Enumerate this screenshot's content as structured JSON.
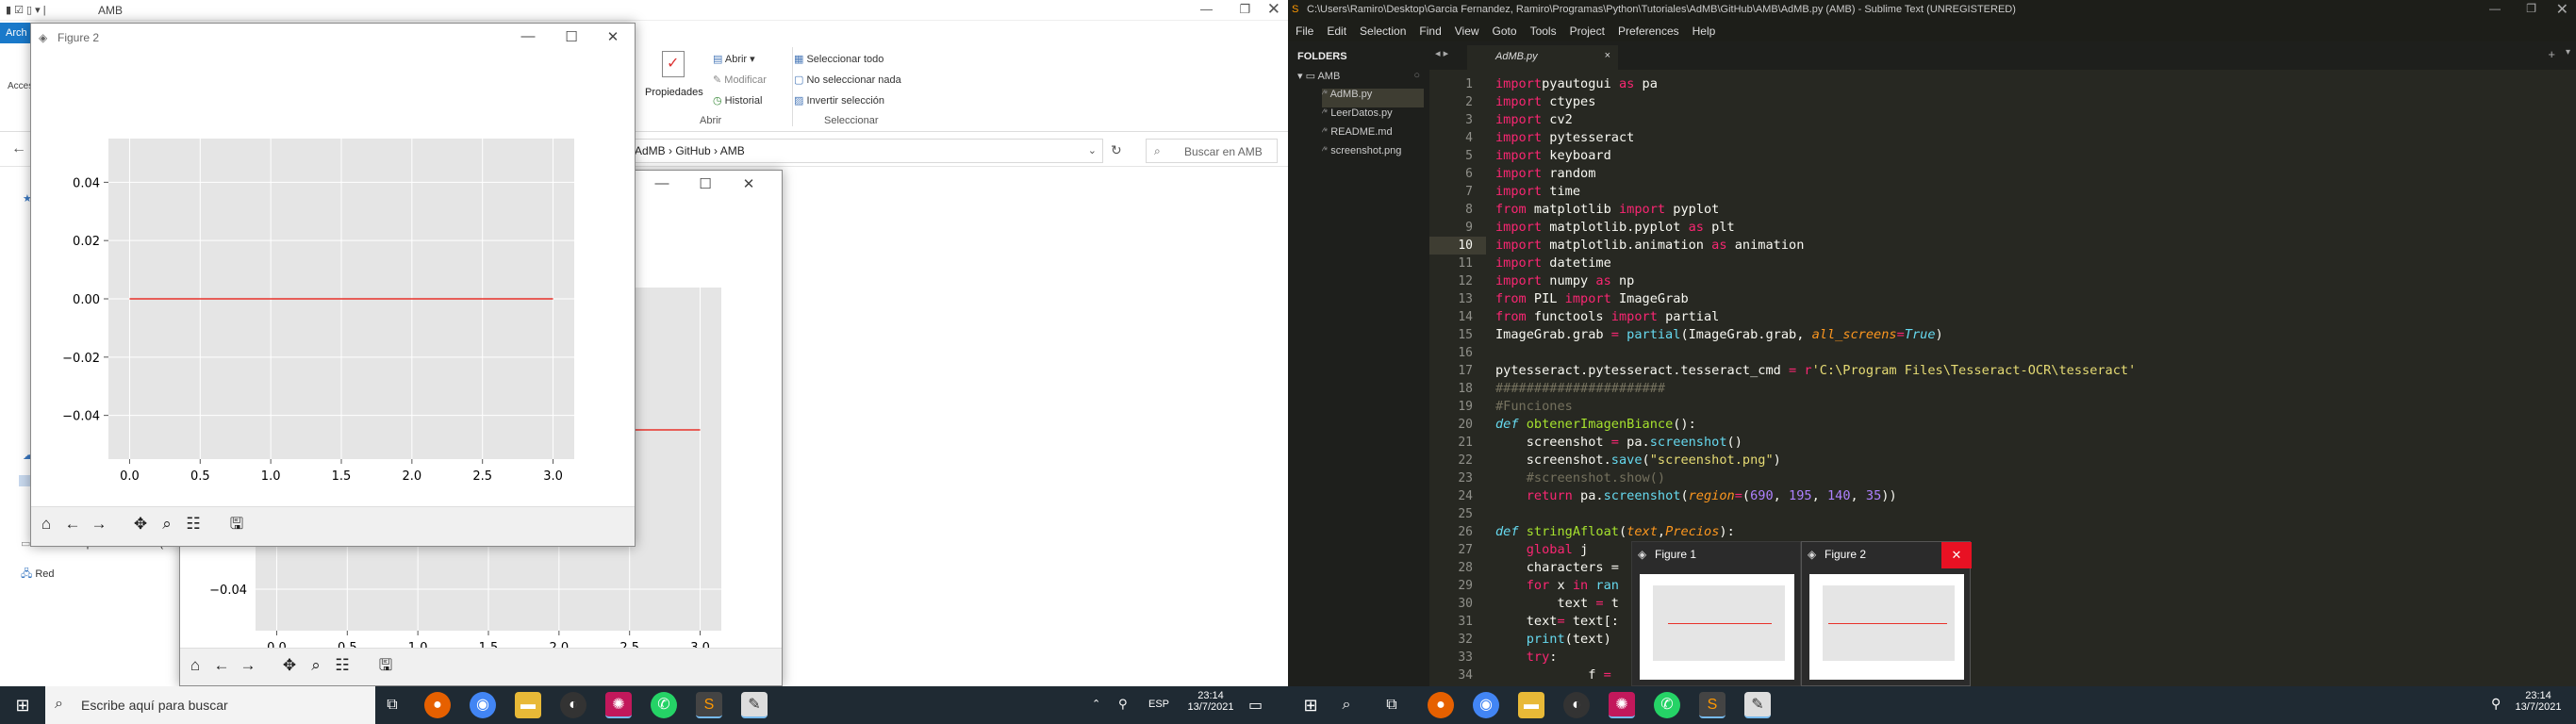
{
  "left": {
    "explorer": {
      "title": "AMB",
      "file_tab": "Arch",
      "ribbon": {
        "propiedades": "Propiedades",
        "abrir": "Abrir",
        "modificar": "Modificar",
        "historial": "Historial",
        "abrir_group": "Abrir",
        "select_all": "Seleccionar todo",
        "select_none": "No seleccionar nada",
        "invert": "Invertir selección",
        "select_group": "Seleccionar",
        "acces": "Acces"
      },
      "breadcrumb": [
        "AdMB",
        "GitHub",
        "AMB"
      ],
      "search_placeholder": "Buscar en AMB",
      "side_labels": {
        "reserved": "Reservado para el sistema (",
        "red": "Red"
      }
    },
    "figure2": {
      "title": "Figure 2",
      "yticks": [
        "0.04",
        "0.02",
        "0.00",
        "−0.02",
        "−0.04"
      ],
      "xticks": [
        "0.0",
        "0.5",
        "1.0",
        "1.5",
        "2.0",
        "2.5",
        "3.0"
      ]
    },
    "figure1": {
      "ytick": "−0.04",
      "xticks": [
        "0.0",
        "0.5",
        "1.0",
        "1.5",
        "2.0",
        "2.5",
        "3.0"
      ]
    },
    "taskbar": {
      "search_placeholder": "Escribe aquí para buscar",
      "lang": "ESP",
      "time": "23:14",
      "date": "13/7/2021"
    }
  },
  "right": {
    "sublime": {
      "title": "C:\\Users\\Ramiro\\Desktop\\Garcia Fernandez, Ramiro\\Programas\\Python\\Tutoriales\\AdMB\\GitHub\\AMB\\AdMB.py (AMB) - Sublime Text (UNREGISTERED)",
      "menu": [
        "File",
        "Edit",
        "Selection",
        "Find",
        "View",
        "Goto",
        "Tools",
        "Project",
        "Preferences",
        "Help"
      ],
      "sidebar": {
        "header": "FOLDERS",
        "folder": "AMB",
        "files": [
          "AdMB.py",
          "LeerDatos.py",
          "README.md",
          "screenshot.png"
        ]
      },
      "tab": "AdMB.py",
      "active_line": "10",
      "lines": [
        [
          "1",
          [
            [
              "kw",
              "import"
            ],
            [
              "",
              "pyautogui"
            ],
            [
              "kw",
              " as"
            ],
            [
              "",
              " pa"
            ]
          ]
        ],
        [
          "2",
          [
            [
              "kw",
              "import"
            ],
            [
              "",
              " ctypes"
            ]
          ]
        ],
        [
          "3",
          [
            [
              "kw",
              "import"
            ],
            [
              "",
              " cv2"
            ]
          ]
        ],
        [
          "4",
          [
            [
              "kw",
              "import"
            ],
            [
              "",
              " pytesseract"
            ]
          ]
        ],
        [
          "5",
          [
            [
              "kw",
              "import"
            ],
            [
              "",
              " keyboard"
            ]
          ]
        ],
        [
          "6",
          [
            [
              "kw",
              "import"
            ],
            [
              "",
              " random"
            ]
          ]
        ],
        [
          "7",
          [
            [
              "kw",
              "import"
            ],
            [
              "",
              " time"
            ]
          ]
        ],
        [
          "8",
          [
            [
              "kw",
              "from"
            ],
            [
              "",
              " matplotlib "
            ],
            [
              "kw",
              "import"
            ],
            [
              "",
              " pyplot"
            ]
          ]
        ],
        [
          "9",
          [
            [
              "kw",
              "import"
            ],
            [
              "",
              " matplotlib.pyplot "
            ],
            [
              "kw",
              "as"
            ],
            [
              "",
              " plt"
            ]
          ]
        ],
        [
          "10",
          [
            [
              "kw",
              "import"
            ],
            [
              "",
              " matplotlib.animation "
            ],
            [
              "kw",
              "as"
            ],
            [
              "",
              " animation"
            ]
          ]
        ],
        [
          "11",
          [
            [
              "kw",
              "import"
            ],
            [
              "",
              " datetime"
            ]
          ]
        ],
        [
          "12",
          [
            [
              "kw",
              "import"
            ],
            [
              "",
              " numpy "
            ],
            [
              "kw",
              "as"
            ],
            [
              "",
              " np"
            ]
          ]
        ],
        [
          "13",
          [
            [
              "kw",
              "from"
            ],
            [
              "",
              " PIL "
            ],
            [
              "kw",
              "import"
            ],
            [
              "",
              " ImageGrab"
            ]
          ]
        ],
        [
          "14",
          [
            [
              "kw",
              "from"
            ],
            [
              "",
              " functools "
            ],
            [
              "kw",
              "import"
            ],
            [
              "",
              " partial"
            ]
          ]
        ],
        [
          "15",
          [
            [
              "",
              "ImageGrab.grab "
            ],
            [
              "kw",
              "="
            ],
            [
              "",
              " "
            ],
            [
              "fn",
              "partial"
            ],
            [
              "",
              "(ImageGrab.grab, "
            ],
            [
              "it",
              "all_screens"
            ],
            [
              "kw",
              "="
            ],
            [
              "bi",
              "True"
            ],
            [
              "",
              ")"
            ]
          ]
        ],
        [
          "16",
          []
        ],
        [
          "17",
          [
            [
              "",
              "pytesseract.pytesseract.tesseract_cmd "
            ],
            [
              "kw",
              "="
            ],
            [
              "",
              " "
            ],
            [
              "kw",
              "r"
            ],
            [
              "st",
              "'C:\\Program Files\\Tesseract-OCR\\tesseract'"
            ]
          ]
        ],
        [
          "18",
          [
            [
              "cm",
              "######################"
            ]
          ]
        ],
        [
          "19",
          [
            [
              "cm",
              "#Funciones"
            ]
          ]
        ],
        [
          "20",
          [
            [
              "bi",
              "def"
            ],
            [
              "",
              " "
            ],
            [
              "gr",
              "obtenerImagenBiance"
            ],
            [
              "",
              "():"
            ]
          ]
        ],
        [
          "21",
          [
            [
              "",
              "    screenshot "
            ],
            [
              "kw",
              "="
            ],
            [
              "",
              " pa."
            ],
            [
              "fn",
              "screenshot"
            ],
            [
              "",
              "()"
            ]
          ]
        ],
        [
          "22",
          [
            [
              "",
              "    screenshot."
            ],
            [
              "fn",
              "save"
            ],
            [
              "",
              "("
            ],
            [
              "st",
              "\"screenshot.png\""
            ],
            [
              "",
              ")"
            ]
          ]
        ],
        [
          "23",
          [
            [
              "cm",
              "    #screenshot.show()"
            ]
          ]
        ],
        [
          "24",
          [
            [
              "kw",
              "    return"
            ],
            [
              "",
              " pa."
            ],
            [
              "fn",
              "screenshot"
            ],
            [
              "",
              "("
            ],
            [
              "it",
              "region"
            ],
            [
              "kw",
              "="
            ],
            [
              "",
              "("
            ],
            [
              "nu",
              "690"
            ],
            [
              "",
              ", "
            ],
            [
              "nu",
              "195"
            ],
            [
              "",
              ", "
            ],
            [
              "nu",
              "140"
            ],
            [
              "",
              ", "
            ],
            [
              "nu",
              "35"
            ],
            [
              "",
              "))"
            ]
          ]
        ],
        [
          "25",
          []
        ],
        [
          "26",
          [
            [
              "bi",
              "def"
            ],
            [
              "",
              " "
            ],
            [
              "gr",
              "stringAfloat"
            ],
            [
              "",
              "("
            ],
            [
              "it",
              "text"
            ],
            [
              "",
              ","
            ],
            [
              "it",
              "Precios"
            ],
            [
              "",
              "):"
            ]
          ]
        ],
        [
          "27",
          [
            [
              "kw",
              "    global"
            ],
            [
              "",
              " j"
            ]
          ]
        ],
        [
          "28",
          [
            [
              "",
              "    characters ="
            ]
          ]
        ],
        [
          "29",
          [
            [
              "kw",
              "    for"
            ],
            [
              "",
              " x "
            ],
            [
              "kw",
              "in"
            ],
            [
              "fn",
              " ran"
            ]
          ]
        ],
        [
          "30",
          [
            [
              "",
              "        text "
            ],
            [
              "kw",
              "="
            ],
            [
              "",
              " t"
            ]
          ]
        ],
        [
          "31",
          [
            [
              "",
              "    text"
            ],
            [
              "kw",
              "="
            ],
            [
              "",
              " text[:"
            ]
          ]
        ],
        [
          "32",
          [
            [
              "fn",
              "    print"
            ],
            [
              "",
              "(text)"
            ]
          ]
        ],
        [
          "33",
          [
            [
              "kw",
              "    try"
            ],
            [
              "",
              ":"
            ]
          ]
        ],
        [
          "34",
          [
            [
              "",
              "            f "
            ],
            [
              "kw",
              "="
            ]
          ]
        ]
      ],
      "previews": [
        {
          "title": "Figure 1"
        },
        {
          "title": "Figure 2"
        }
      ]
    },
    "taskbar": {
      "time": "23:14",
      "date": "13/7/2021"
    }
  },
  "chart_data": [
    {
      "type": "line",
      "title": "Figure 2",
      "series": [
        {
          "values": [
            0,
            0
          ]
        }
      ],
      "x": [
        0,
        3
      ],
      "xlim": [
        -0.15,
        3.15
      ],
      "ylim": [
        -0.055,
        0.055
      ],
      "xticks": [
        0,
        0.5,
        1,
        1.5,
        2,
        2.5,
        3
      ],
      "yticks": [
        0.04,
        0.02,
        0,
        -0.02,
        -0.04
      ],
      "grid": true
    },
    {
      "type": "line",
      "title": "Figure 1",
      "series": [
        {
          "values": [
            -0.03,
            -0.03
          ]
        }
      ],
      "x": [
        2,
        3
      ],
      "xlim": [
        -0.15,
        3.15
      ],
      "grid": true
    }
  ],
  "colors": {
    "line": "#e8322a",
    "plot_bg": "#e5e5e5",
    "grid": "#ffffff",
    "st_bg": "#272822",
    "taskbar": "#1f2a33",
    "close_red": "#e81123"
  }
}
